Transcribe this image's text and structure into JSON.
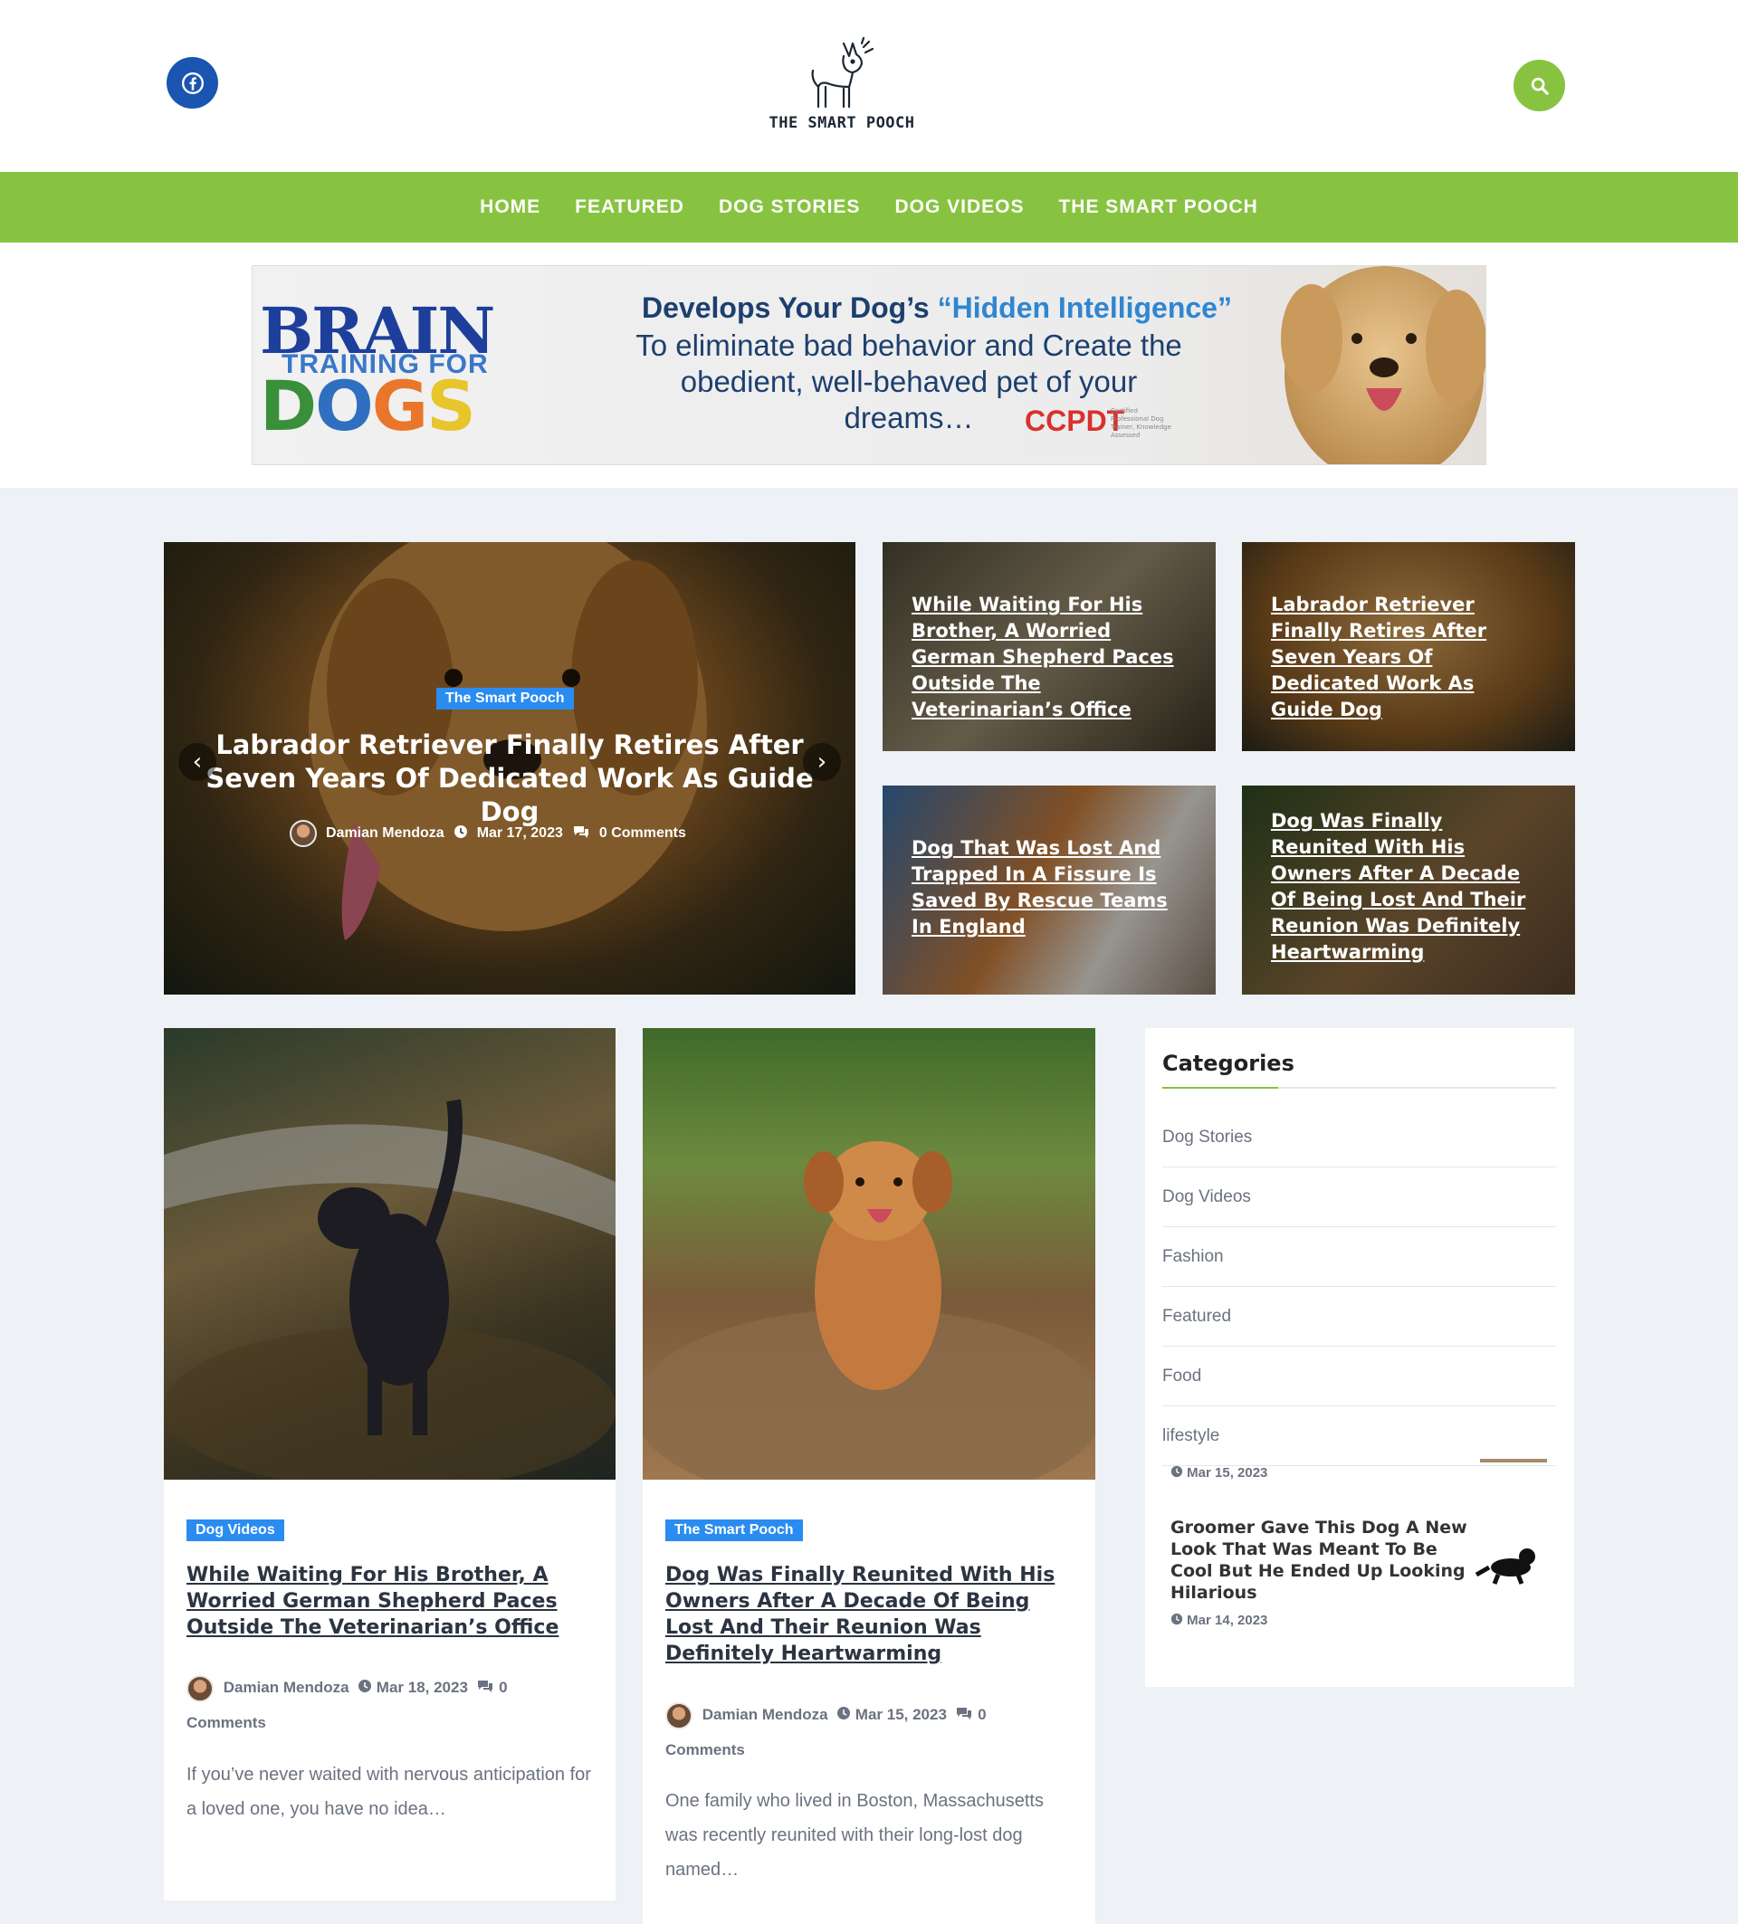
{
  "brand": {
    "name": "THE SMART POOCH",
    "facebook_icon": "facebook-icon",
    "search_icon": "search-icon",
    "accent": "#87c341",
    "facebook_color": "#1a55b1",
    "category_badge_color": "#2a8cf0"
  },
  "nav": [
    "HOME",
    "FEATURED",
    "DOG STORIES",
    "DOG VIDEOS",
    "THE SMART POOCH"
  ],
  "ad": {
    "brain": "BRAIN",
    "training_for": "TRAINING FOR",
    "dogs": "DOGS",
    "headline_prefix": "Develops Your Dog’s ",
    "headline_highlight": "“Hidden Intelligence”",
    "subtext": "To eliminate bad behavior and Create the obedient, well-behaved pet of your dreams…",
    "badge": "CCPDT",
    "badge_small": "Certified Professional Dog Trainer, Knowledge Assessed"
  },
  "hero": {
    "category": "The Smart Pooch",
    "title": "Labrador Retriever Finally Retires After Seven Years Of Dedicated Work As Guide Dog",
    "author": "Damian Mendoza",
    "date": "Mar 17, 2023",
    "comments": "0 Comments"
  },
  "tiles": [
    "While Waiting For His Brother, A Worried German Shepherd Paces Outside The Veterinarian’s Office",
    "Labrador Retriever Finally Retires After Seven Years Of Dedicated Work As Guide Dog",
    "Dog That Was Lost And Trapped In A Fissure Is Saved By Rescue Teams In England",
    "Dog Was Finally Reunited With His Owners After A Decade Of Being Lost And Their Reunion Was Definitely Heartwarming"
  ],
  "posts": [
    {
      "category": "Dog Videos",
      "title": "While Waiting For His Brother, A Worried German Shepherd Paces Outside The Veterinarian’s Office",
      "author": "Damian Mendoza",
      "date": "Mar 18, 2023",
      "comments_count": "0",
      "comments_label": "Comments",
      "excerpt": "If you’ve never waited with nervous anticipation for a loved one, you have no idea…"
    },
    {
      "category": "The Smart Pooch",
      "title": "Dog Was Finally Reunited With His Owners After A Decade Of Being Lost And Their Reunion Was Definitely Heartwarming",
      "author": "Damian Mendoza",
      "date": "Mar 15, 2023",
      "comments_count": "0",
      "comments_label": "Comments",
      "excerpt": "One family who lived in Boston, Massachusetts was recently reunited with their long-lost dog named…"
    }
  ],
  "sidebar": {
    "title": "Categories",
    "categories": [
      "Dog Stories",
      "Dog Videos",
      "Fashion",
      "Featured",
      "Food",
      "lifestyle"
    ],
    "recent": [
      {
        "date": "Mar 15, 2023"
      },
      {
        "title": "Groomer Gave This Dog A New Look That Was Meant To Be Cool But He Ended Up Looking Hilarious",
        "date": "Mar 14, 2023"
      }
    ]
  }
}
